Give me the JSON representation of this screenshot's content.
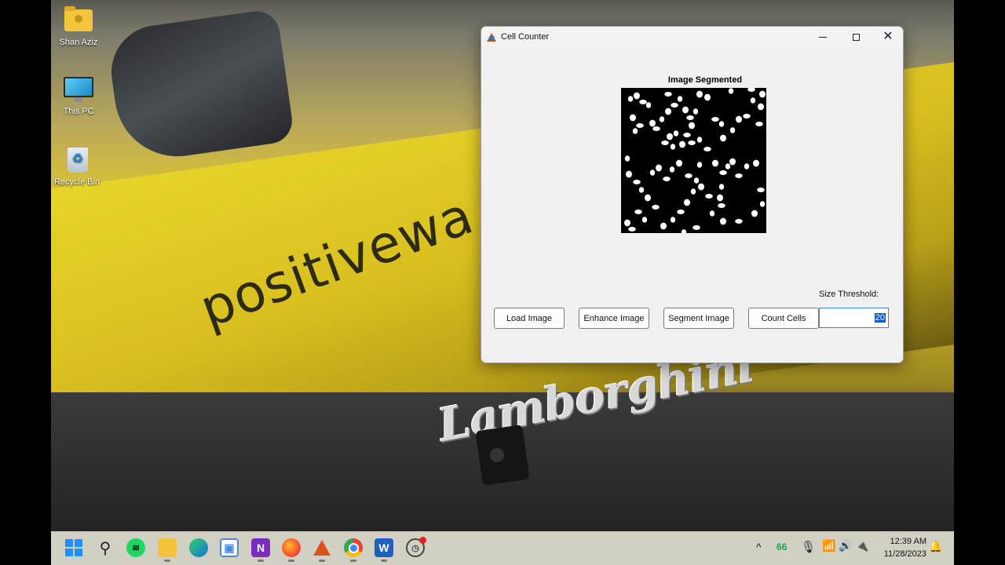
{
  "desktop": {
    "icons": [
      {
        "label": "Shan Aziz",
        "icon": "user-folder-icon"
      },
      {
        "label": "This PC",
        "icon": "computer-icon"
      },
      {
        "label": "Recycle Bin",
        "icon": "recycle-bin-icon"
      }
    ],
    "wallpaper": {
      "text": "positivewa",
      "logo": "Lamborghini"
    }
  },
  "window": {
    "title": "Cell Counter",
    "controls": {
      "minimize": "–",
      "maximize": "□",
      "close": "✕"
    },
    "plot_title": "Image Segmented",
    "buttons": {
      "load": "Load Image",
      "enhance": "Enhance Image",
      "segment": "Segment Image",
      "count": "Count Cells"
    },
    "size_threshold": {
      "label": "Size Threshold:",
      "value": "20"
    }
  },
  "taskbar": {
    "apps": [
      "start-icon",
      "search-icon",
      "spotify-icon",
      "file-explorer-icon",
      "edge-icon",
      "store-icon",
      "onenote-icon",
      "firefox-icon",
      "matlab-icon",
      "chrome-icon",
      "word-icon",
      "clock-icon"
    ],
    "app_glyphs": {
      "search": "⚲",
      "spotify": "≋",
      "onenote": "N",
      "word": "W",
      "store": "▣",
      "clock": "◷"
    },
    "tray": {
      "chevron": "^",
      "battery_percent": "66",
      "mic": "🎙",
      "wifi": "📶",
      "volume": "🔊",
      "power": "🔌",
      "time": "12:39 AM",
      "date": "11/28/2023",
      "notification": "🔔"
    }
  }
}
